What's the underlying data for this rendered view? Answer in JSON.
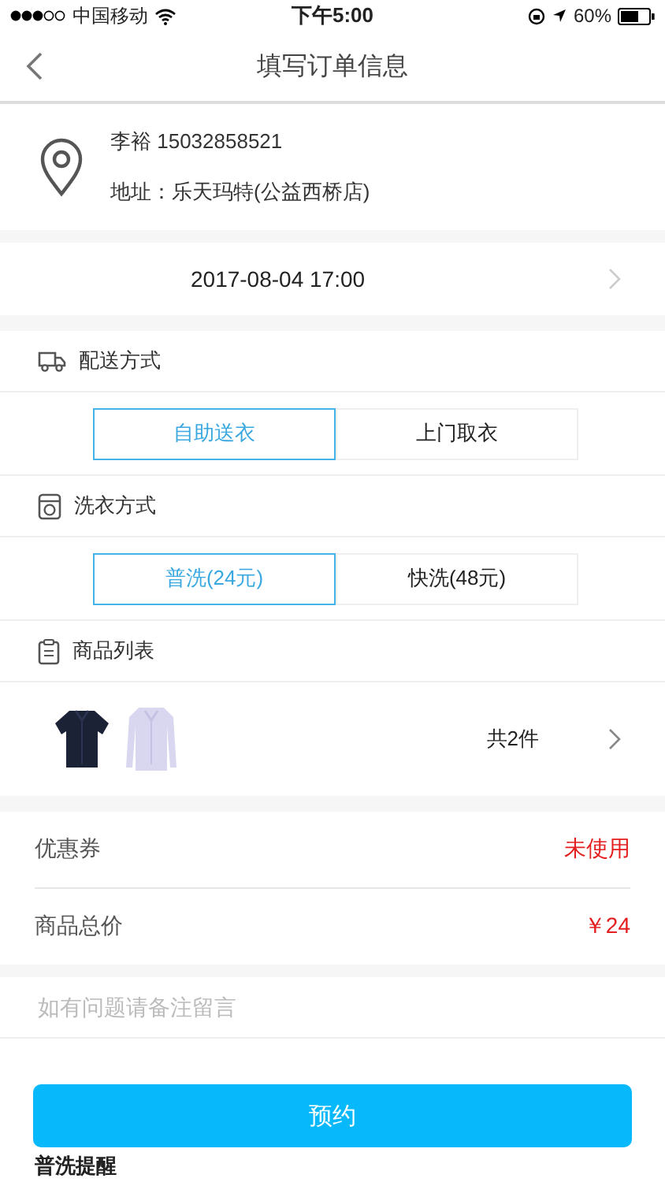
{
  "status_bar": {
    "carrier": "中国移动",
    "time": "下午5:00",
    "battery": "60%"
  },
  "nav": {
    "title": "填写订单信息"
  },
  "address": {
    "contact": "李裕 15032858521",
    "address": "地址：乐天玛特(公益西桥店)"
  },
  "datetime": "2017-08-04 17:00",
  "sections": [
    {
      "kind": "delivery",
      "title": "配送方式",
      "options": [
        {
          "label": "自助送衣",
          "selected": true
        },
        {
          "label": "上门取衣",
          "selected": false
        }
      ]
    },
    {
      "kind": "wash",
      "title": "洗衣方式",
      "options": [
        {
          "label": "普洗(24元)",
          "selected": true
        },
        {
          "label": "快洗(48元)",
          "selected": false
        }
      ]
    }
  ],
  "goods": {
    "title": "商品列表",
    "count": "共2件"
  },
  "summary": [
    {
      "label": "优惠券",
      "value": "未使用"
    },
    {
      "label": "商品总价",
      "value": "￥24"
    }
  ],
  "note": {
    "placeholder": "如有问题请备注留言"
  },
  "submit": "预约",
  "footer_heading": "普洗提醒"
}
